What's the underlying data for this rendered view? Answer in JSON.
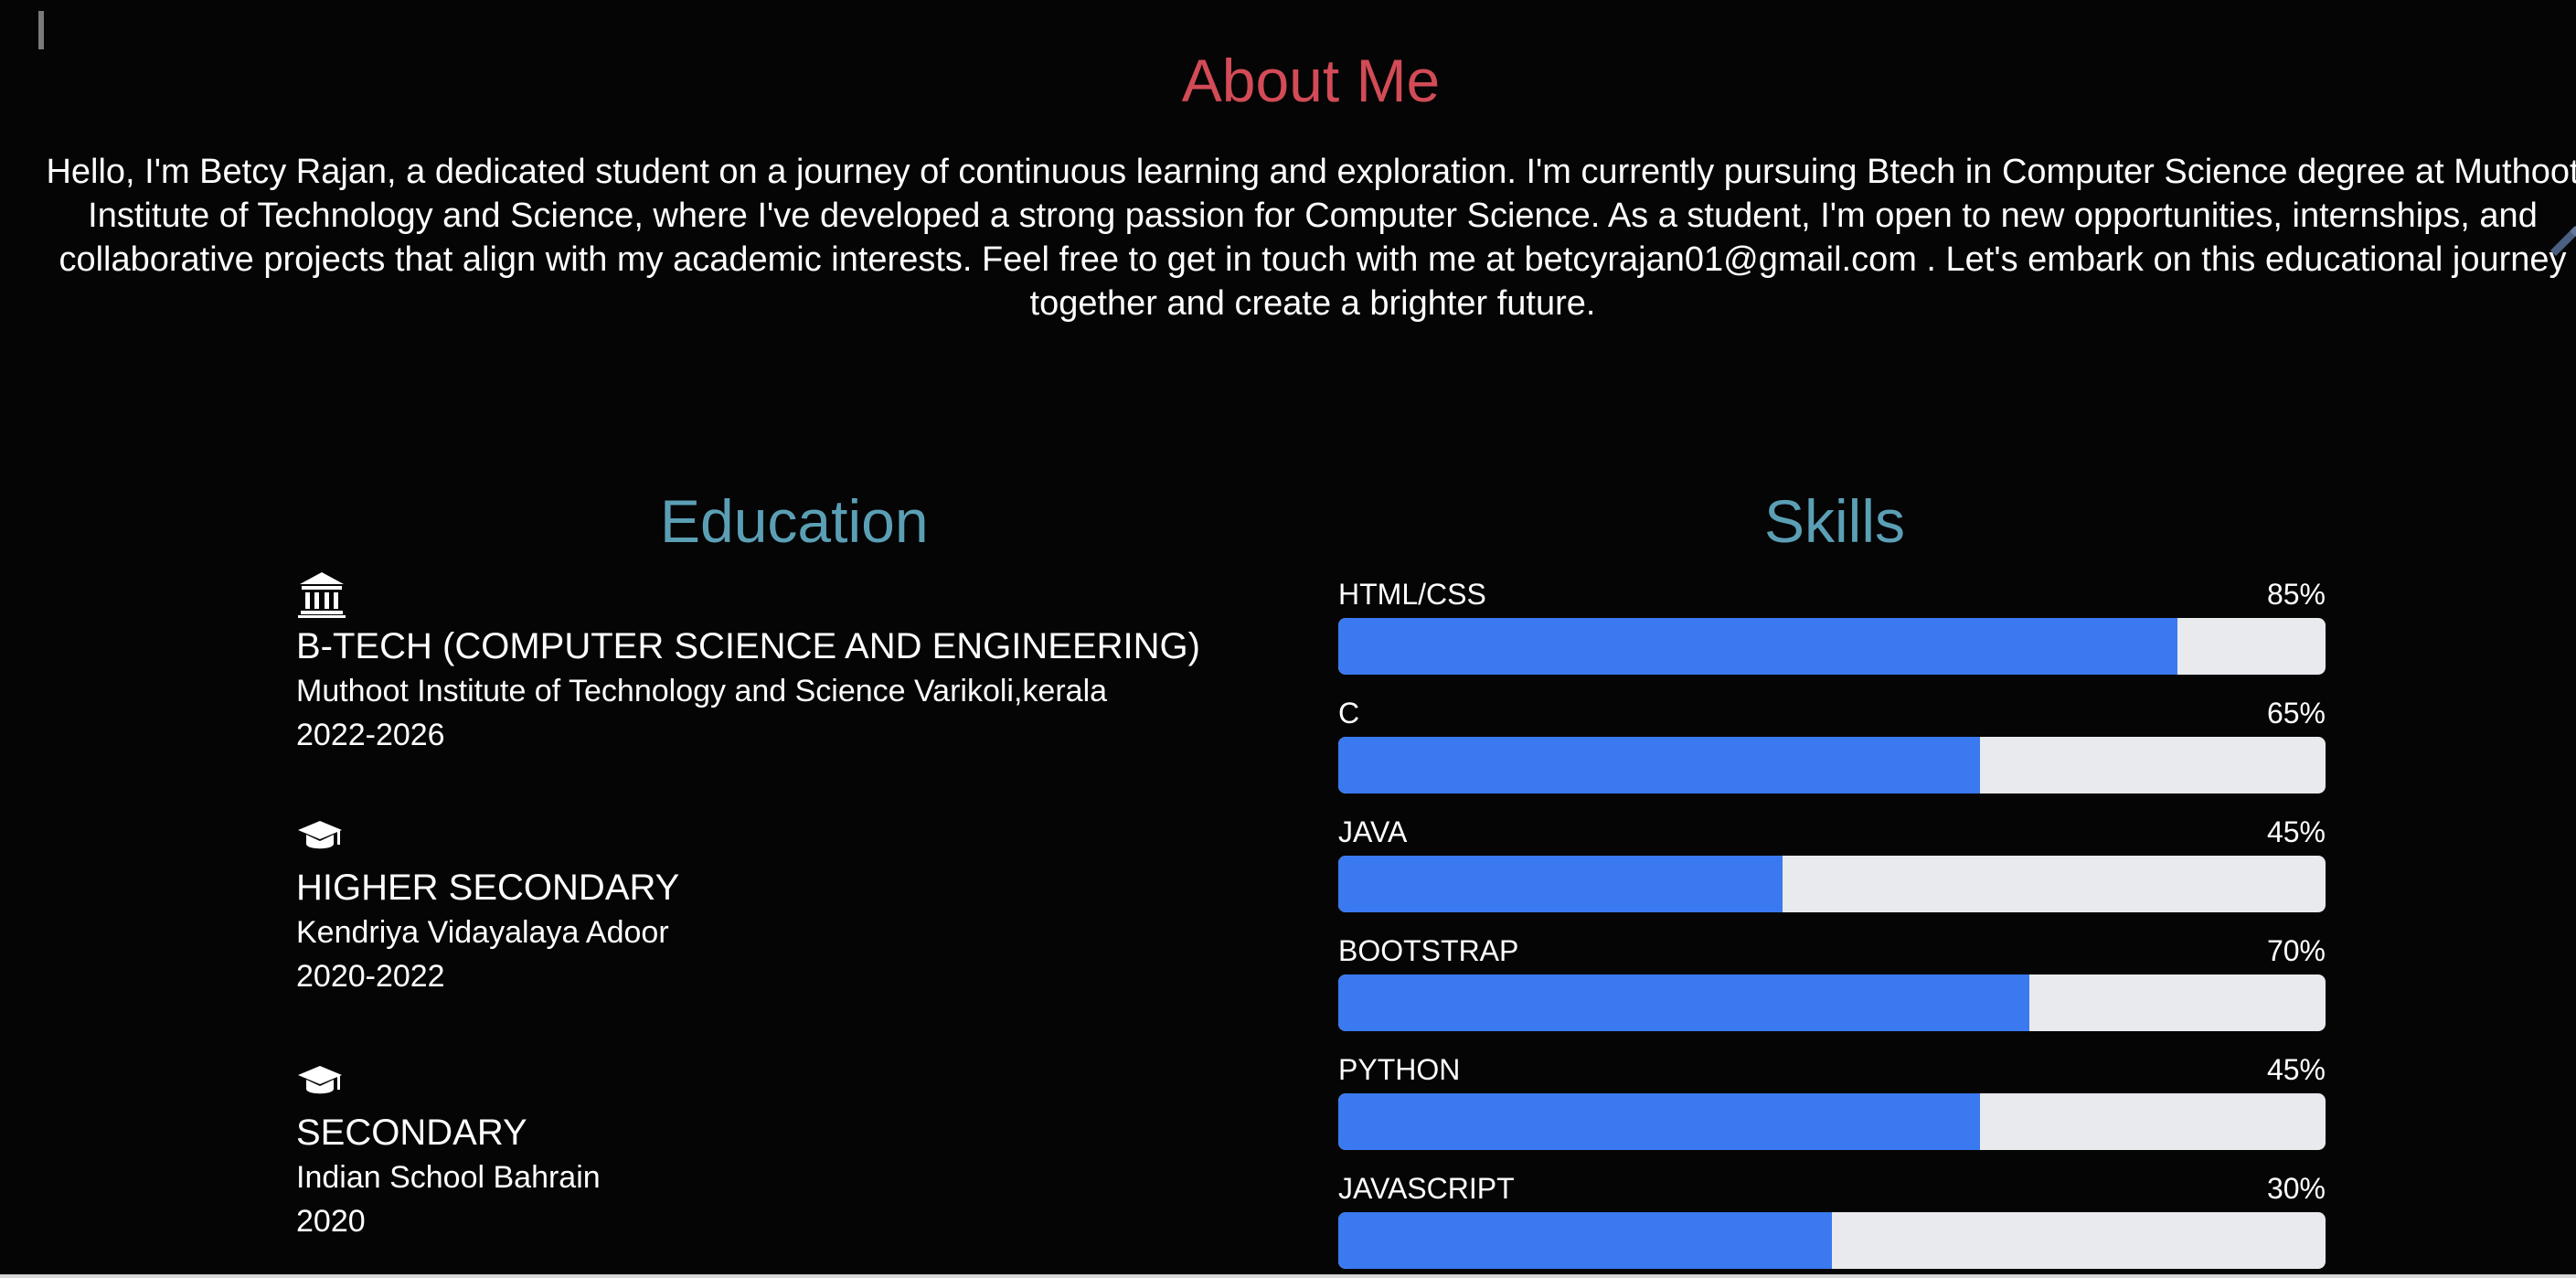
{
  "about": {
    "title": "About Me",
    "text": "Hello, I'm Betcy Rajan, a dedicated student on a journey of continuous learning and exploration. I'm currently pursuing Btech in Computer Science degree at Muthoot Institute of Technology and Science, where I've developed a strong passion for Computer Science. As a student, I'm open to new opportunities, internships, and collaborative projects that align with my academic interests. Feel free to get in touch with me at betcyrajan01@gmail.com . Let's embark on this educational journey together and create a brighter future."
  },
  "education": {
    "title": "Education",
    "items": [
      {
        "icon": "institution-icon",
        "degree": "B-TECH (COMPUTER SCIENCE AND ENGINEERING)",
        "school": "Muthoot Institute of Technology and Science Varikoli,kerala",
        "years": "2022-2026"
      },
      {
        "icon": "graduation-cap-icon",
        "degree": "HIGHER SECONDARY",
        "school": "Kendriya Vidayalaya Adoor",
        "years": "2020-2022"
      },
      {
        "icon": "graduation-cap-icon",
        "degree": "SECONDARY",
        "school": "Indian School Bahrain",
        "years": "2020"
      }
    ]
  },
  "skills": {
    "title": "Skills",
    "items": [
      {
        "name": "HTML/CSS",
        "percent": "85%",
        "fill": 85
      },
      {
        "name": "C",
        "percent": "65%",
        "fill": 65
      },
      {
        "name": "JAVA",
        "percent": "45%",
        "fill": 45
      },
      {
        "name": "BOOTSTRAP",
        "percent": "70%",
        "fill": 70
      },
      {
        "name": "PYTHON",
        "percent": "45%",
        "fill": 65
      },
      {
        "name": "JAVASCRIPT",
        "percent": "30%",
        "fill": 50
      }
    ]
  },
  "colors": {
    "background": "#050505",
    "about_title": "#d24b56",
    "section_title": "#5b9fb5",
    "bar_fill": "#3a79ef",
    "bar_track": "#e8eaee"
  }
}
